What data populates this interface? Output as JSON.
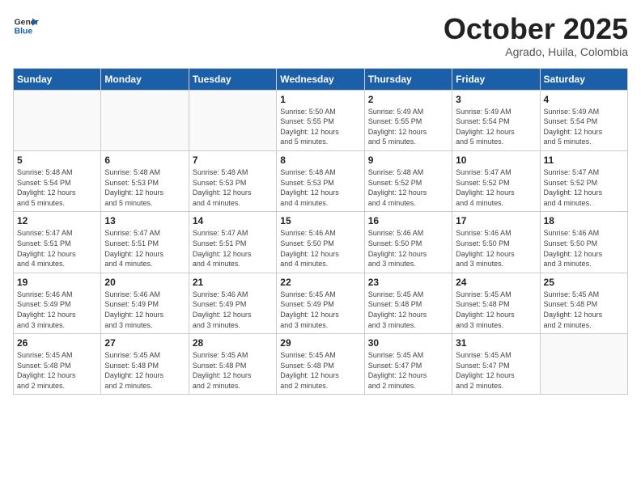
{
  "header": {
    "logo_line1": "General",
    "logo_line2": "Blue",
    "month": "October 2025",
    "location": "Agrado, Huila, Colombia"
  },
  "weekdays": [
    "Sunday",
    "Monday",
    "Tuesday",
    "Wednesday",
    "Thursday",
    "Friday",
    "Saturday"
  ],
  "weeks": [
    [
      {
        "day": "",
        "info": ""
      },
      {
        "day": "",
        "info": ""
      },
      {
        "day": "",
        "info": ""
      },
      {
        "day": "1",
        "info": "Sunrise: 5:50 AM\nSunset: 5:55 PM\nDaylight: 12 hours\nand 5 minutes."
      },
      {
        "day": "2",
        "info": "Sunrise: 5:49 AM\nSunset: 5:55 PM\nDaylight: 12 hours\nand 5 minutes."
      },
      {
        "day": "3",
        "info": "Sunrise: 5:49 AM\nSunset: 5:54 PM\nDaylight: 12 hours\nand 5 minutes."
      },
      {
        "day": "4",
        "info": "Sunrise: 5:49 AM\nSunset: 5:54 PM\nDaylight: 12 hours\nand 5 minutes."
      }
    ],
    [
      {
        "day": "5",
        "info": "Sunrise: 5:48 AM\nSunset: 5:54 PM\nDaylight: 12 hours\nand 5 minutes."
      },
      {
        "day": "6",
        "info": "Sunrise: 5:48 AM\nSunset: 5:53 PM\nDaylight: 12 hours\nand 5 minutes."
      },
      {
        "day": "7",
        "info": "Sunrise: 5:48 AM\nSunset: 5:53 PM\nDaylight: 12 hours\nand 4 minutes."
      },
      {
        "day": "8",
        "info": "Sunrise: 5:48 AM\nSunset: 5:53 PM\nDaylight: 12 hours\nand 4 minutes."
      },
      {
        "day": "9",
        "info": "Sunrise: 5:48 AM\nSunset: 5:52 PM\nDaylight: 12 hours\nand 4 minutes."
      },
      {
        "day": "10",
        "info": "Sunrise: 5:47 AM\nSunset: 5:52 PM\nDaylight: 12 hours\nand 4 minutes."
      },
      {
        "day": "11",
        "info": "Sunrise: 5:47 AM\nSunset: 5:52 PM\nDaylight: 12 hours\nand 4 minutes."
      }
    ],
    [
      {
        "day": "12",
        "info": "Sunrise: 5:47 AM\nSunset: 5:51 PM\nDaylight: 12 hours\nand 4 minutes."
      },
      {
        "day": "13",
        "info": "Sunrise: 5:47 AM\nSunset: 5:51 PM\nDaylight: 12 hours\nand 4 minutes."
      },
      {
        "day": "14",
        "info": "Sunrise: 5:47 AM\nSunset: 5:51 PM\nDaylight: 12 hours\nand 4 minutes."
      },
      {
        "day": "15",
        "info": "Sunrise: 5:46 AM\nSunset: 5:50 PM\nDaylight: 12 hours\nand 4 minutes."
      },
      {
        "day": "16",
        "info": "Sunrise: 5:46 AM\nSunset: 5:50 PM\nDaylight: 12 hours\nand 3 minutes."
      },
      {
        "day": "17",
        "info": "Sunrise: 5:46 AM\nSunset: 5:50 PM\nDaylight: 12 hours\nand 3 minutes."
      },
      {
        "day": "18",
        "info": "Sunrise: 5:46 AM\nSunset: 5:50 PM\nDaylight: 12 hours\nand 3 minutes."
      }
    ],
    [
      {
        "day": "19",
        "info": "Sunrise: 5:46 AM\nSunset: 5:49 PM\nDaylight: 12 hours\nand 3 minutes."
      },
      {
        "day": "20",
        "info": "Sunrise: 5:46 AM\nSunset: 5:49 PM\nDaylight: 12 hours\nand 3 minutes."
      },
      {
        "day": "21",
        "info": "Sunrise: 5:46 AM\nSunset: 5:49 PM\nDaylight: 12 hours\nand 3 minutes."
      },
      {
        "day": "22",
        "info": "Sunrise: 5:45 AM\nSunset: 5:49 PM\nDaylight: 12 hours\nand 3 minutes."
      },
      {
        "day": "23",
        "info": "Sunrise: 5:45 AM\nSunset: 5:48 PM\nDaylight: 12 hours\nand 3 minutes."
      },
      {
        "day": "24",
        "info": "Sunrise: 5:45 AM\nSunset: 5:48 PM\nDaylight: 12 hours\nand 3 minutes."
      },
      {
        "day": "25",
        "info": "Sunrise: 5:45 AM\nSunset: 5:48 PM\nDaylight: 12 hours\nand 2 minutes."
      }
    ],
    [
      {
        "day": "26",
        "info": "Sunrise: 5:45 AM\nSunset: 5:48 PM\nDaylight: 12 hours\nand 2 minutes."
      },
      {
        "day": "27",
        "info": "Sunrise: 5:45 AM\nSunset: 5:48 PM\nDaylight: 12 hours\nand 2 minutes."
      },
      {
        "day": "28",
        "info": "Sunrise: 5:45 AM\nSunset: 5:48 PM\nDaylight: 12 hours\nand 2 minutes."
      },
      {
        "day": "29",
        "info": "Sunrise: 5:45 AM\nSunset: 5:48 PM\nDaylight: 12 hours\nand 2 minutes."
      },
      {
        "day": "30",
        "info": "Sunrise: 5:45 AM\nSunset: 5:47 PM\nDaylight: 12 hours\nand 2 minutes."
      },
      {
        "day": "31",
        "info": "Sunrise: 5:45 AM\nSunset: 5:47 PM\nDaylight: 12 hours\nand 2 minutes."
      },
      {
        "day": "",
        "info": ""
      }
    ]
  ]
}
